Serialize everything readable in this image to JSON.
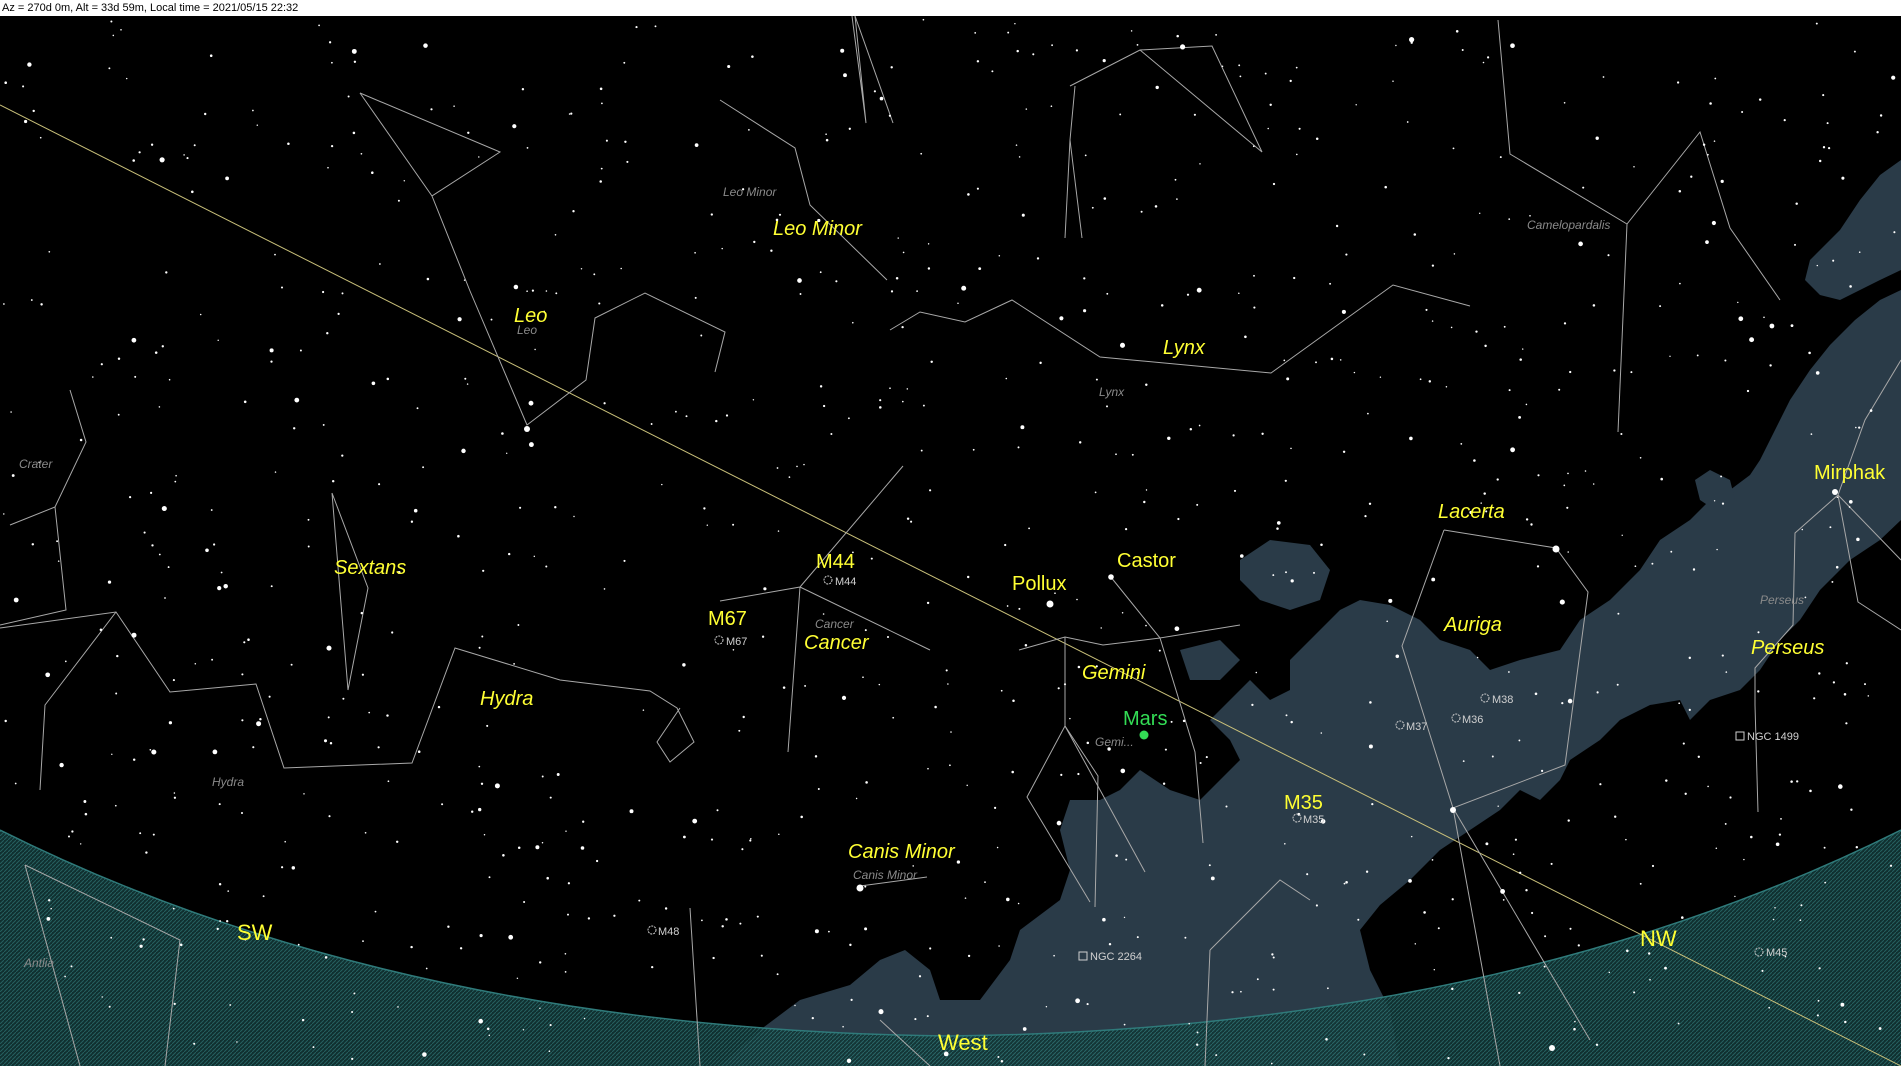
{
  "status_bar": {
    "text": "Az = 270d 0m, Alt = 33d 59m, Local time = 2021/05/15 22:32"
  },
  "colors": {
    "background": "#000000",
    "constellation_lines": "#a8a8a8",
    "ecliptic": "#c9c07a",
    "label_yellow": "#ffff33",
    "label_grey": "#8a8a8a",
    "milky_way": "#2a3b48",
    "horizon": "#1e4a4a",
    "mars": "#33dd55"
  },
  "constellations": {
    "leo": "Leo",
    "leo_grey": "Leo",
    "leo_minor": "Leo Minor",
    "leo_minor_grey": "Leo Minor",
    "lynx": "Lynx",
    "lynx_grey": "Lynx",
    "camelopardalis_grey": "Camelopardalis",
    "crater_grey": "Crater",
    "sextans": "Sextans",
    "hydra": "Hydra",
    "hydra_grey": "Hydra",
    "cancer": "Cancer",
    "cancer_grey": "Cancer",
    "gemini": "Gemini",
    "gemini_grey": "Gemi...",
    "canis_minor": "Canis Minor",
    "canis_minor_grey": "Canis Minor",
    "lacerta": "Lacerta",
    "auriga": "Auriga",
    "perseus": "Perseus",
    "perseus_grey": "Perseus",
    "antlia_grey": "Antlia"
  },
  "named_objects": {
    "pollux": "Pollux",
    "castor": "Castor",
    "mars": "Mars",
    "mirphak": "Mirphak",
    "m44_big": "M44",
    "m44_small": "M44",
    "m67_big": "M67",
    "m67_small": "M67",
    "m35_big": "M35",
    "m35_small": "M35",
    "m37": "M37",
    "m36": "M36",
    "m38": "M38",
    "m48": "M48",
    "m45": "M45",
    "ngc1499": "NGC 1499",
    "ngc2264": "NGC 2264"
  },
  "compass": {
    "sw": "SW",
    "west": "West",
    "nw": "NW"
  }
}
